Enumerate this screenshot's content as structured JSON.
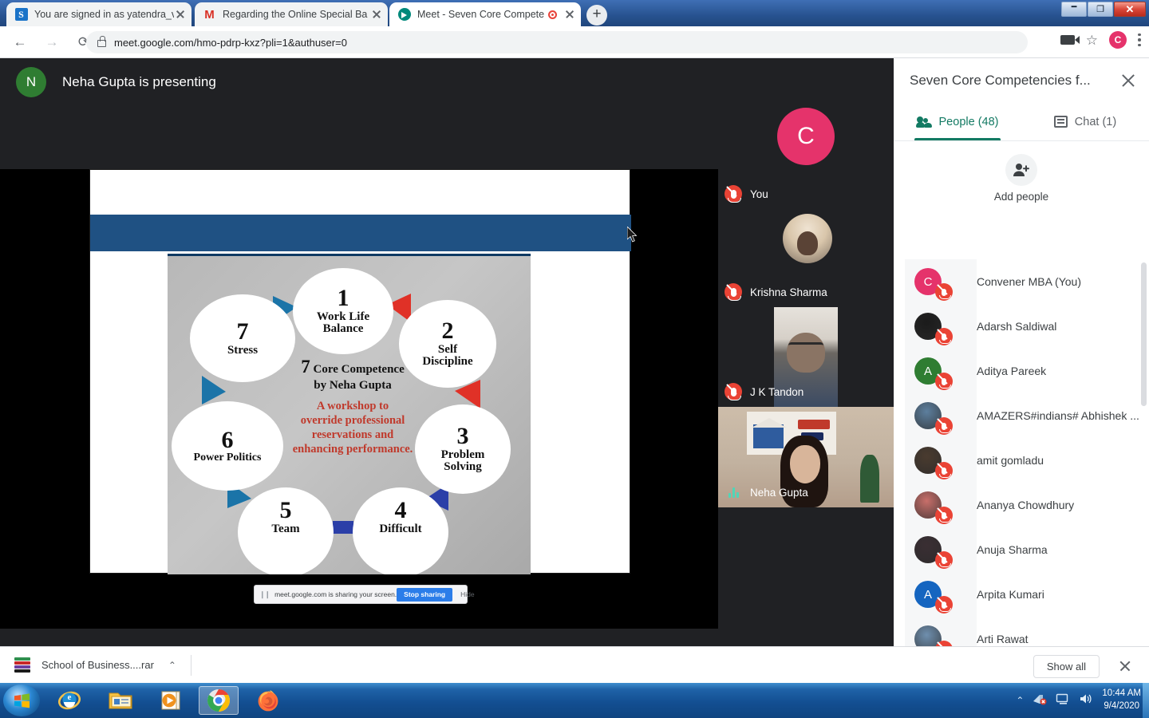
{
  "browser": {
    "tabs": [
      {
        "title": "You are signed in as yatendra_ve",
        "favicon": "skype-icon",
        "active": false,
        "recording": false
      },
      {
        "title": "Regarding the Online Special Ba",
        "favicon": "gmail-icon",
        "active": false,
        "recording": false
      },
      {
        "title": "Meet - Seven Core Compete",
        "favicon": "google-meet-icon",
        "active": true,
        "recording": true
      }
    ],
    "new_tab_label": "+",
    "window_controls": {
      "minimize": "–",
      "restore": "❐",
      "close": "✕"
    },
    "url": "meet.google.com/hmo-pdrp-kxz?pli=1&authuser=0",
    "back_label": "←",
    "forward_label": "→",
    "reload_label": "⟳",
    "profile_initial": "C"
  },
  "meet": {
    "presenting_banner": {
      "avatar_initial": "N",
      "avatar_color": "#2f7d32",
      "text": "Neha Gupta is presenting"
    },
    "slide": {
      "band_color": "#1f5183",
      "center": {
        "number": "7",
        "title": "Core Competence",
        "byline": "by Neha Gupta",
        "subtitle_lines": [
          "A workshop to",
          "override professional",
          "reservations and",
          "enhancing performance."
        ],
        "subtitle_color": "#c0392b"
      },
      "bubbles": [
        {
          "number": "1",
          "label_lines": [
            "Work Life",
            "Balance"
          ]
        },
        {
          "number": "2",
          "label_lines": [
            "Self",
            "Discipline"
          ]
        },
        {
          "number": "3",
          "label_lines": [
            "Problem",
            "Solving"
          ]
        },
        {
          "number": "4",
          "label_lines": [
            "Difficult"
          ]
        },
        {
          "number": "5",
          "label_lines": [
            "Team"
          ]
        },
        {
          "number": "6",
          "label_lines": [
            "Power Politics"
          ]
        },
        {
          "number": "7",
          "label_lines": [
            "Stress"
          ]
        }
      ]
    },
    "share_bar": {
      "message": "meet.google.com is sharing your screen.",
      "stop_label": "Stop sharing",
      "hide_label": "Hide",
      "pause_glyph": "❙❙"
    },
    "video_tiles": [
      {
        "name": "You",
        "kind": "initial",
        "initial": "C",
        "color": "#e5336b",
        "muted": true,
        "speaking": false
      },
      {
        "name": "Krishna Sharma",
        "kind": "photo",
        "color": "#d6c7b0",
        "muted": true,
        "speaking": false
      },
      {
        "name": "J K Tandon",
        "kind": "video",
        "color": "#5d5650",
        "muted": true,
        "speaking": false
      },
      {
        "name": "Neha Gupta",
        "kind": "video",
        "color": "#b9a391",
        "muted": false,
        "speaking": true
      }
    ]
  },
  "panel": {
    "title": "Seven Core Competencies f...",
    "close_label": "✕",
    "tabs": [
      {
        "label": "People (48)",
        "icon": "people-icon",
        "selected": true
      },
      {
        "label": "Chat (1)",
        "icon": "chat-icon",
        "selected": false
      }
    ],
    "accent_color": "#137a63",
    "add_people": {
      "label": "Add people",
      "icon": "add-person-icon"
    },
    "participants": [
      {
        "name": "Convener MBA (You)",
        "kind": "initial",
        "initial": "C",
        "color": "#e5336b",
        "muted": true
      },
      {
        "name": "Adarsh Saldiwal",
        "kind": "photo",
        "color": "#1b1b1b",
        "muted": true
      },
      {
        "name": "Aditya Pareek",
        "kind": "initial",
        "initial": "A",
        "color": "#2f7d32",
        "muted": true
      },
      {
        "name": "AMAZERS#indians# Abhishek ...",
        "kind": "photo",
        "color": "#5d7f9e",
        "muted": true
      },
      {
        "name": "amit gomladu",
        "kind": "photo",
        "color": "#4a3b2f",
        "muted": true
      },
      {
        "name": "Ananya Chowdhury",
        "kind": "photo",
        "color": "#c86f6a",
        "muted": true
      },
      {
        "name": "Anuja Sharma",
        "kind": "photo",
        "color": "#3a2e33",
        "muted": true
      },
      {
        "name": "Arpita Kumari",
        "kind": "initial",
        "initial": "A",
        "color": "#1565c0",
        "muted": true
      },
      {
        "name": "Arti Rawat",
        "kind": "photo",
        "color": "#6f8fae",
        "muted": true
      },
      {
        "name": "",
        "kind": "photo",
        "color": "#8d9aa6",
        "muted": false
      }
    ]
  },
  "downloads": {
    "file_name": "School of Business....rar",
    "caret": "⌃",
    "show_all_label": "Show all",
    "close_label": "✕"
  },
  "taskbar": {
    "items": [
      "start-orb",
      "internet-explorer",
      "file-explorer",
      "media-player",
      "google-chrome",
      "mozilla-firefox"
    ],
    "active_item": "google-chrome",
    "tray": {
      "expand": "⌃",
      "time": "10:44 AM",
      "date": "9/4/2020"
    }
  }
}
